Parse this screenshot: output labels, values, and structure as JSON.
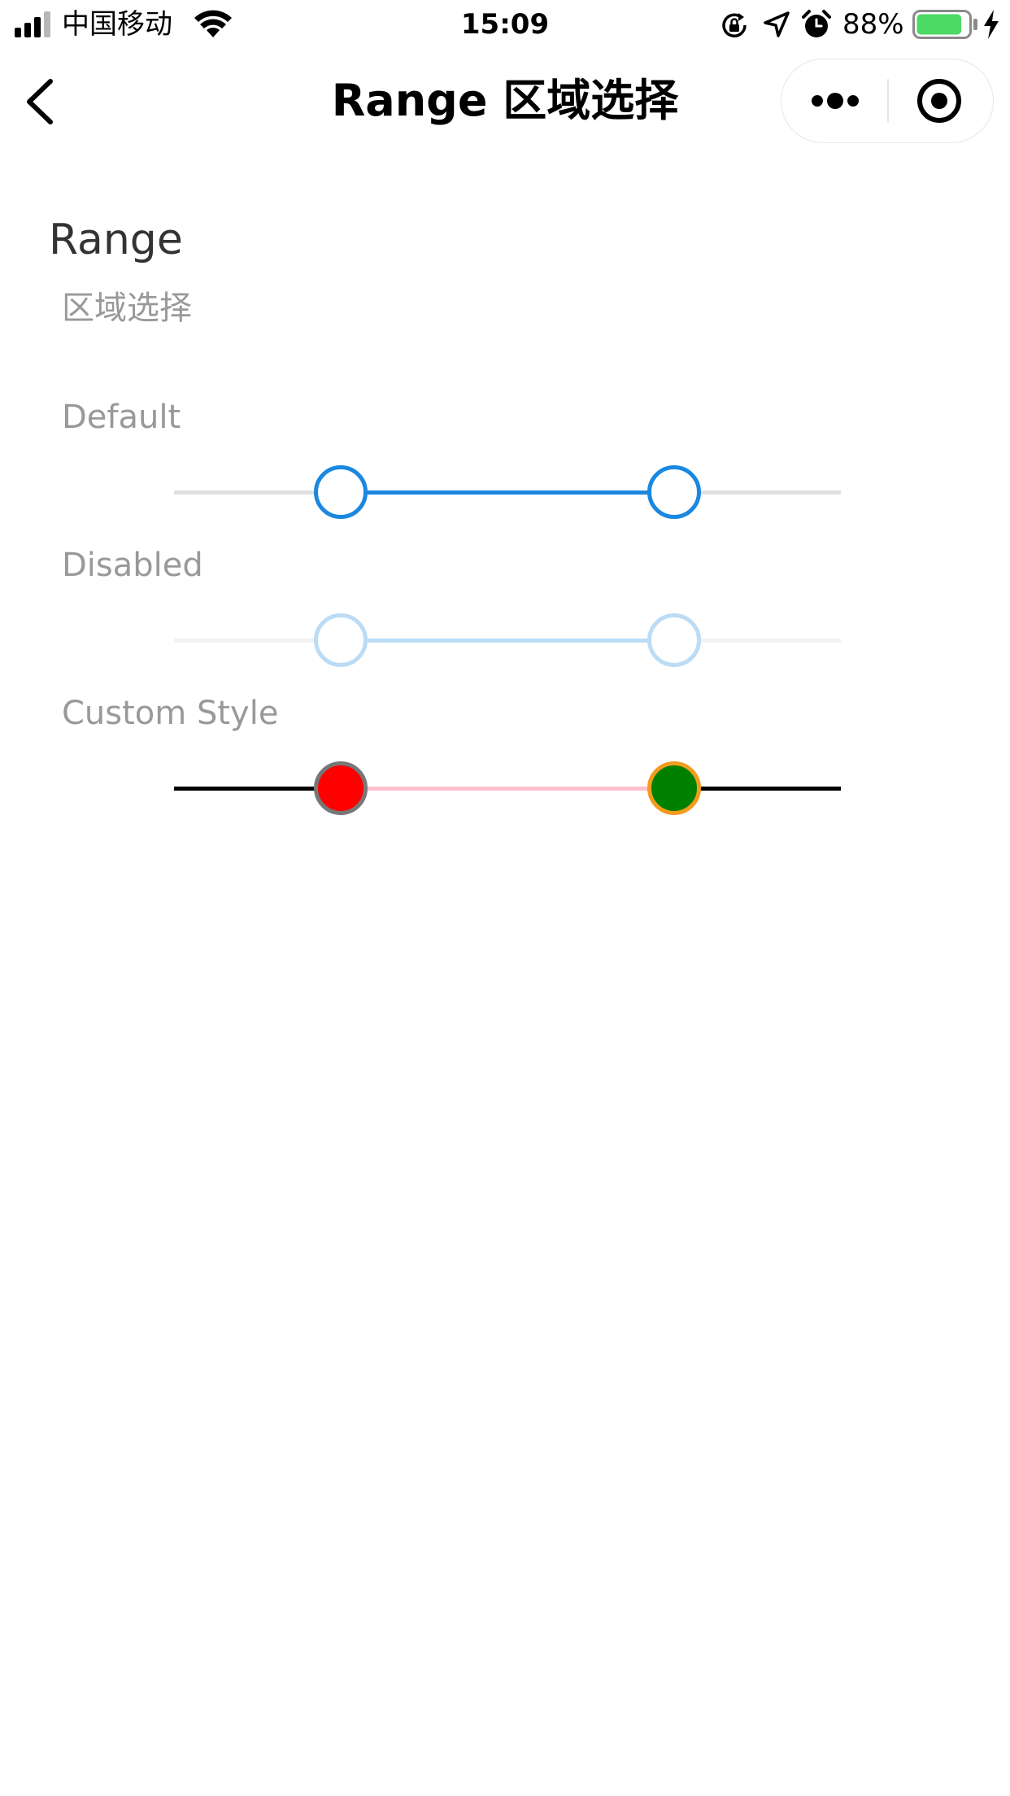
{
  "status_bar": {
    "carrier": "中国移动",
    "time": "15:09",
    "battery_percent": "88%",
    "battery_level": 0.88,
    "icons": [
      "signal-icon",
      "wifi-icon",
      "lock-rotation-icon",
      "location-icon",
      "alarm-icon",
      "battery-icon",
      "charging-icon"
    ]
  },
  "nav": {
    "title": "Range 区域选择",
    "back_icon": "chevron-left-icon",
    "more_icon": "more-dots-icon",
    "close_icon": "target-close-icon"
  },
  "header": {
    "title": "Range",
    "subtitle": "区域选择"
  },
  "sections": [
    {
      "label": "Default",
      "min": 0,
      "max": 100,
      "low": 25,
      "high": 75,
      "disabled": false,
      "colors": {
        "track": "#e0e0e0",
        "fill": "#1a88e0",
        "handle_border": "#1a88e0",
        "handle_bg": "#ffffff"
      }
    },
    {
      "label": "Disabled",
      "min": 0,
      "max": 100,
      "low": 25,
      "high": 75,
      "disabled": true,
      "colors": {
        "track": "#f2f2f2",
        "fill": "#bcdcf5",
        "handle_border": "#bcdcf5",
        "handle_bg": "#ffffff"
      }
    },
    {
      "label": "Custom Style",
      "min": 0,
      "max": 100,
      "low": 25,
      "high": 75,
      "disabled": false,
      "colors": {
        "track": "#000000",
        "fill": "#ffc0cb",
        "low_handle_border": "#777777",
        "low_handle_bg": "#ff0000",
        "high_handle_border": "#f39c1f",
        "high_handle_bg": "#008000"
      }
    }
  ]
}
